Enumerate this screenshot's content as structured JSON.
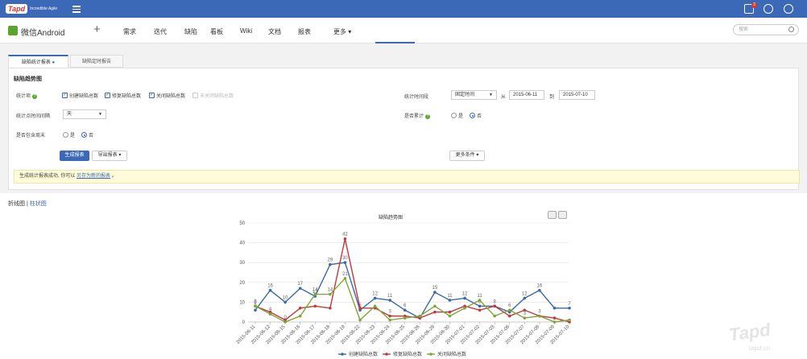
{
  "topbar": {
    "logo_text": "Tapd",
    "logo_sub": "Incredible Agile",
    "notification_count": "3",
    "icons": [
      "menu-icon",
      "notification-icon",
      "clock-icon",
      "user-icon"
    ],
    "color": "#3b68b7"
  },
  "project": {
    "name": "微信Android",
    "nav": [
      "需求",
      "迭代",
      "缺陷",
      "看板",
      "Wiki",
      "文档",
      "报表",
      "更多 ▾"
    ],
    "search_placeholder": "搜索"
  },
  "tabs": [
    "缺陷统计报表",
    "缺陷定时报告"
  ],
  "section_title": "缺陷趋势图",
  "form": {
    "stat_item_label": "统计项",
    "checkboxes": [
      {
        "label": "创建缺陷总数",
        "checked": true
      },
      {
        "label": "修复缺陷总数",
        "checked": true
      },
      {
        "label": "关闭缺陷总数",
        "checked": true
      },
      {
        "label": "未关闭缺陷总数",
        "checked": false
      }
    ],
    "stat_interval_label": "统计点时间间隔",
    "stat_interval_value": "天",
    "include_weekend_label": "是否包含周末",
    "yes": "是",
    "no": "否",
    "stat_period_label": "统计时间段",
    "period_type": "固定时间",
    "from_label": "从",
    "from_date": "2015-06-11",
    "to_label": "到",
    "to_date": "2015-07-10",
    "cumulative_label": "是否累计",
    "generate_button": "生成报表",
    "export_button": "导出报表 ▾",
    "more_conditions_button": "更多条件 ▾"
  },
  "notice": {
    "text": "生成统计报表成功, 你可以",
    "link": "另存为新的报表",
    "suffix": "。"
  },
  "chart_switch": {
    "line": "折线图",
    "separator": " | ",
    "bar": "柱状图"
  },
  "chart_data": {
    "type": "line",
    "title": "缺陷趋势图",
    "categories": [
      "2015-06-11",
      "2015-06-12",
      "2015-06-15",
      "2015-06-16",
      "2015-06-17",
      "2015-06-18",
      "2015-06-19",
      "2015-06-22",
      "2015-06-23",
      "2015-06-24",
      "2015-06-25",
      "2015-06-26",
      "2015-06-29",
      "2015-06-30",
      "2015-07-01",
      "2015-07-02",
      "2015-07-03",
      "2015-07-06",
      "2015-07-07",
      "2015-07-08",
      "2015-07-09",
      "2015-07-10"
    ],
    "ylim": [
      0,
      50
    ],
    "yticks": [
      0,
      10,
      20,
      30,
      40,
      50
    ],
    "legend_position": "bottom",
    "series": [
      {
        "name": "创建缺陷总数",
        "color": "#3a6aa9",
        "values": [
          6,
          16,
          10,
          17,
          13,
          29,
          30,
          6,
          12,
          11,
          6,
          2,
          15,
          11,
          12,
          8,
          8,
          5,
          12,
          16,
          7,
          7
        ]
      },
      {
        "name": "修复缺陷总数",
        "color": "#c0393b",
        "values": [
          8,
          5,
          1,
          7,
          8,
          7,
          42,
          7,
          7,
          3,
          3,
          2,
          5,
          5,
          8,
          6,
          8,
          3,
          6,
          3,
          2,
          0
        ]
      },
      {
        "name": "关闭缺陷总数",
        "color": "#7fa53a",
        "values": [
          8,
          4,
          0,
          3,
          14,
          14,
          22,
          1,
          8,
          1,
          2,
          3,
          8,
          3,
          7,
          11,
          3,
          6,
          2,
          3,
          0,
          1
        ]
      }
    ],
    "visible_labels": [
      [
        "8",
        "16",
        "10",
        "17",
        "13",
        "29",
        "30",
        "6",
        "12",
        "11",
        "6",
        "",
        "15",
        "11",
        "12",
        "8",
        "8",
        "",
        "12",
        "16",
        "",
        "7"
      ],
      [
        "8",
        "",
        "",
        "",
        "",
        "",
        "42",
        "",
        "",
        "3",
        "",
        "",
        "",
        "",
        "",
        "",
        "",
        "",
        "",
        "3",
        "",
        ""
      ],
      [
        "8",
        "4",
        "0",
        "",
        "14",
        "14",
        "21",
        "",
        "",
        "",
        "",
        "",
        "",
        "",
        "",
        "11",
        "",
        "6",
        "3",
        "",
        "",
        ""
      ]
    ]
  },
  "watermark": {
    "text": "Tapd",
    "sub": "tapd.cn"
  }
}
